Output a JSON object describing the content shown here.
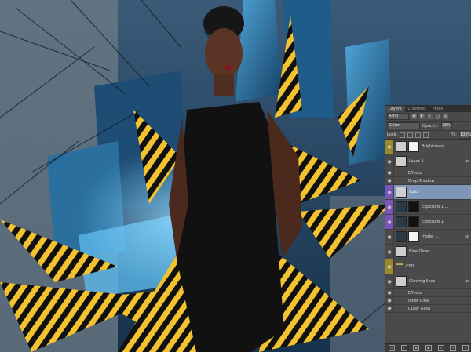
{
  "panel": {
    "tabs": [
      "Layers",
      "Channels",
      "Paths"
    ],
    "active_tab": "Layers",
    "filter_kind": "Kind",
    "blend_mode": "Color",
    "opacity_label": "Opacity:",
    "opacity_value": "25%",
    "lock_label": "Lock:",
    "fill_label": "Fill:",
    "fill_value": "100%",
    "layers": [
      {
        "name": "Brightness/...",
        "visible_color": "gold",
        "type": "adjustment"
      },
      {
        "name": "Layer 1",
        "visible_color": "",
        "type": "pixel",
        "fx": "fx"
      },
      {
        "name": "Effects",
        "sub": true
      },
      {
        "name": "Drop Shadow",
        "sub": true
      },
      {
        "name": "Color",
        "visible_color": "purple",
        "type": "pixel",
        "selected": true
      },
      {
        "name": "Exposure 1 ...",
        "visible_color": "purple",
        "type": "adjustment"
      },
      {
        "name": "Exposure 1",
        "visible_color": "purple",
        "type": "adjustment"
      },
      {
        "name": "model ...",
        "visible_color": "",
        "type": "pixel",
        "fx": "fx"
      },
      {
        "name": "Blue Glow",
        "visible_color": "",
        "type": "pixel"
      },
      {
        "name": "CYD",
        "visible_color": "gold",
        "type": "folder"
      },
      {
        "name": "Glowing lines",
        "visible_color": "",
        "type": "pixel",
        "fx": "fx"
      },
      {
        "name": "Effects",
        "sub": true
      },
      {
        "name": "Inner Glow",
        "sub": true
      },
      {
        "name": "Outer Glow",
        "sub": true
      }
    ]
  },
  "colors": {
    "accent_yellow": "#f2c230",
    "city_blue": "#2a6f9e",
    "panel_gray": "#4a4a4a",
    "selected_blue": "#7e97b8"
  }
}
